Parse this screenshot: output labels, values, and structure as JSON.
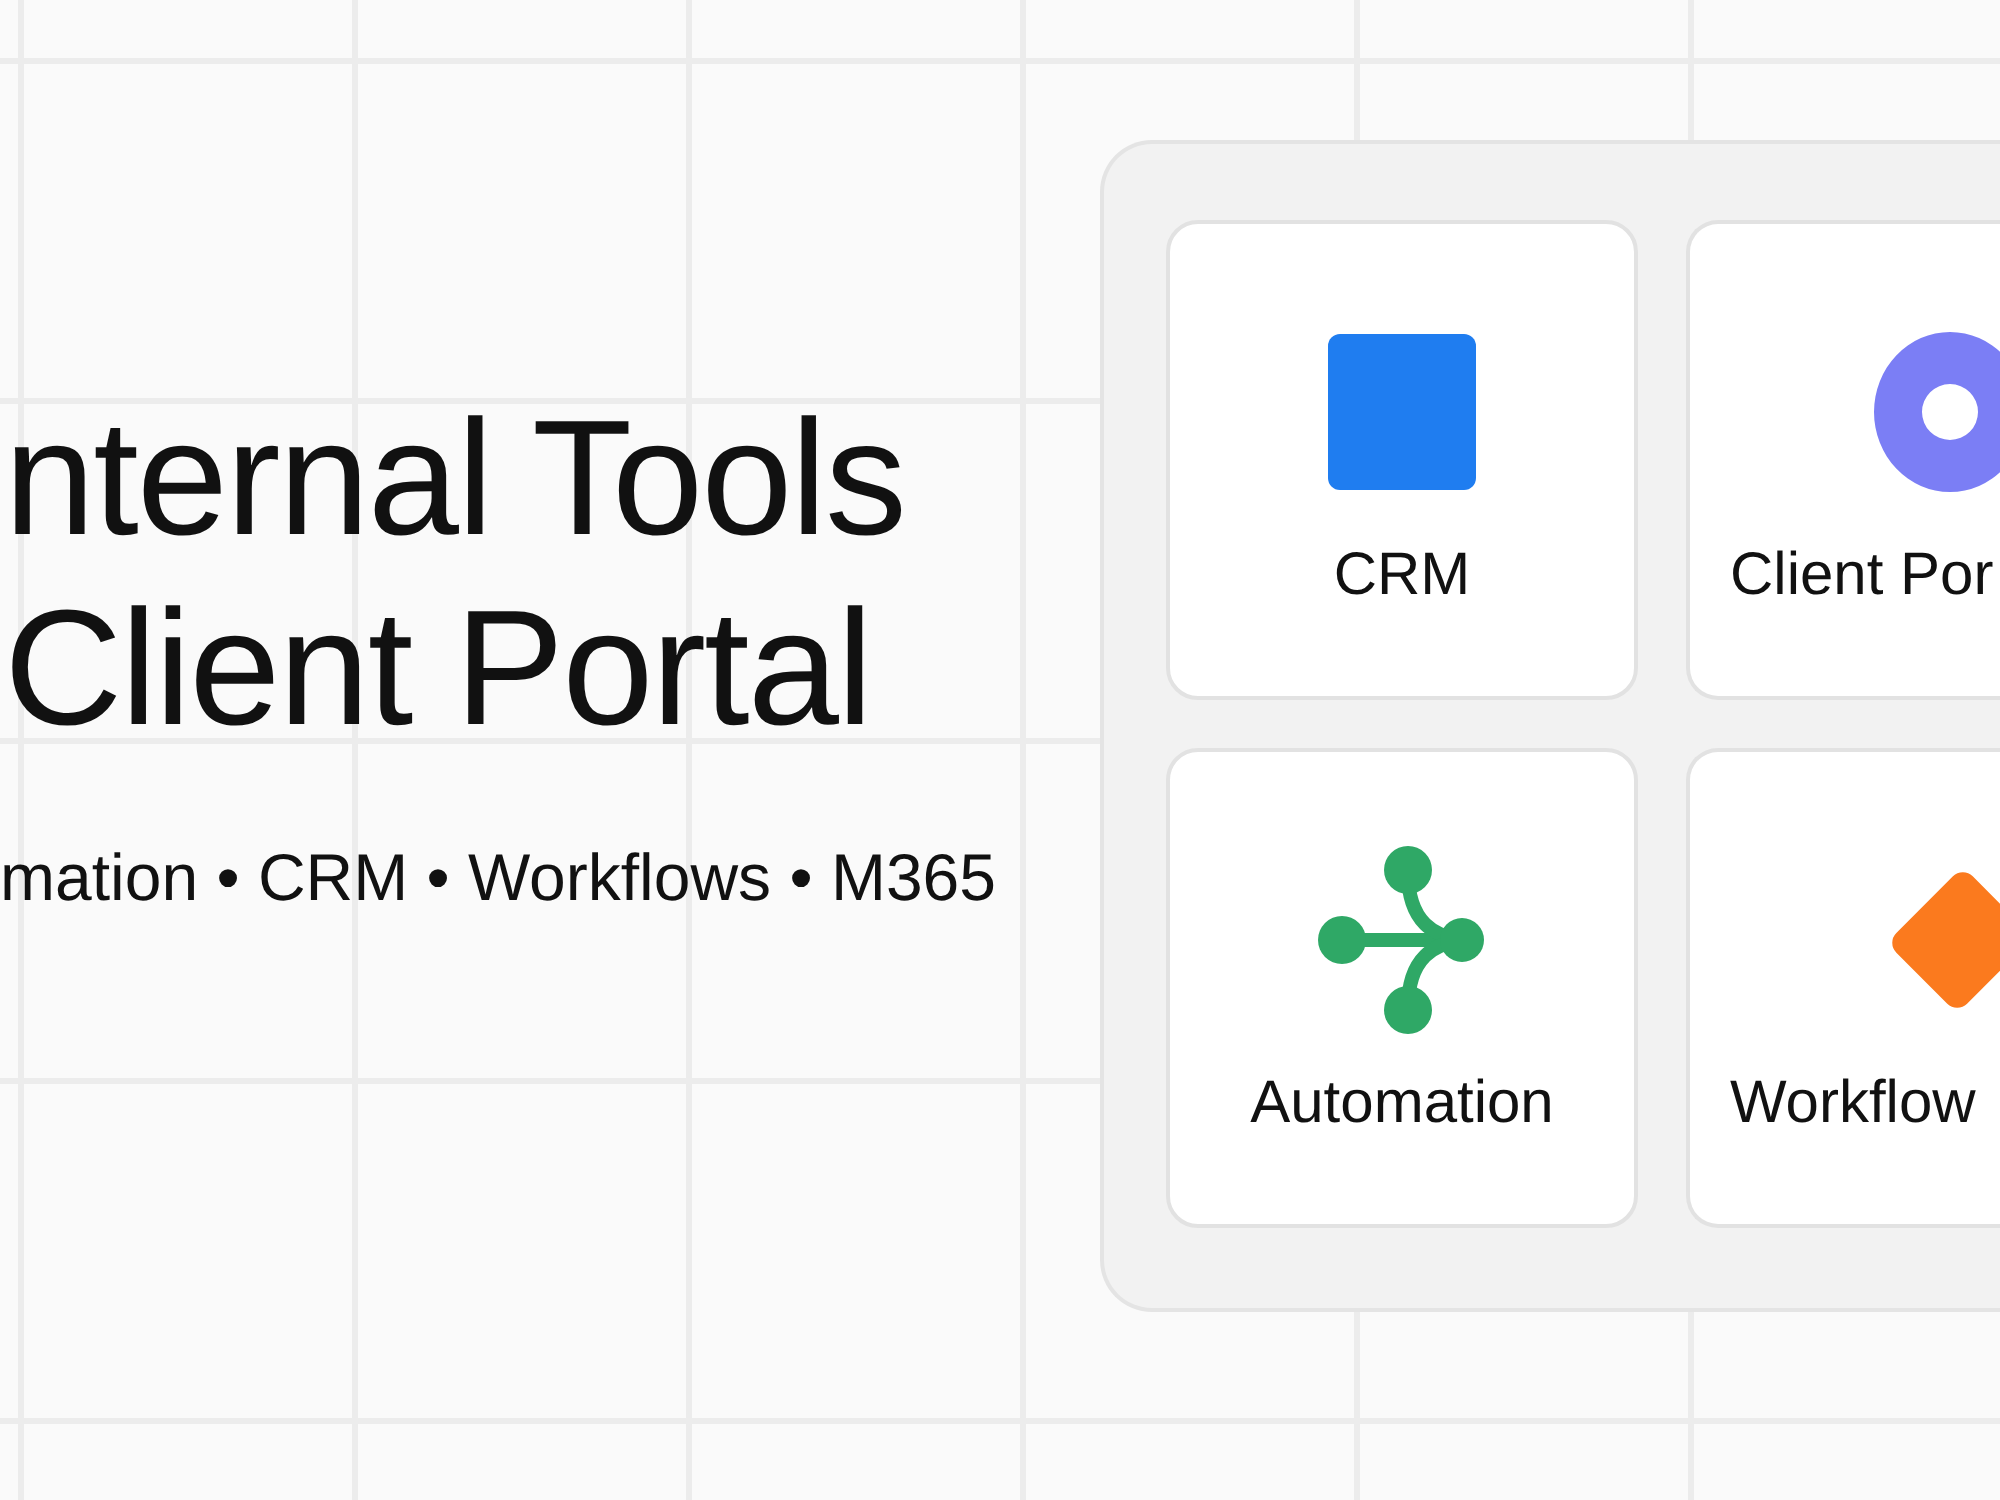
{
  "headline": {
    "lines": [
      "nternal Tools",
      "Client Portal"
    ]
  },
  "subtitle": "mation • CRM • Workflows • M365",
  "cards": [
    {
      "label": "CRM",
      "kind": "square",
      "color": "#1f7df0"
    },
    {
      "label": "Client Por",
      "kind": "ring",
      "color": "#7b7ef5"
    },
    {
      "label": "Automation",
      "kind": "branch",
      "color": "#2fa866"
    },
    {
      "label": "Workflow",
      "kind": "diamond",
      "color": "#fb7a1e"
    }
  ]
}
